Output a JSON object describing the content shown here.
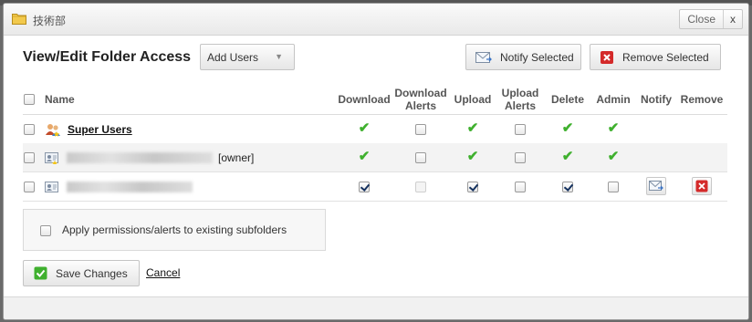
{
  "window": {
    "title": "技術部",
    "close_label": "Close",
    "close_x": "x"
  },
  "heading": "View/Edit Folder Access",
  "toolbar": {
    "add_users_label": "Add Users",
    "notify_selected_label": "Notify Selected",
    "remove_selected_label": "Remove Selected"
  },
  "table": {
    "columns": {
      "name": "Name",
      "download": "Download",
      "download_alerts": "Download Alerts",
      "upload": "Upload",
      "upload_alerts": "Upload Alerts",
      "delete": "Delete",
      "admin": "Admin",
      "notify": "Notify",
      "remove": "Remove"
    },
    "rows": [
      {
        "name": "Super Users",
        "type": "group",
        "download": "granted",
        "download_alerts": "unchecked",
        "upload": "granted",
        "upload_alerts": "unchecked",
        "delete": "granted",
        "admin": "granted"
      },
      {
        "name_suffix": "[owner]",
        "type": "user",
        "download": "granted",
        "download_alerts": "unchecked",
        "upload": "granted",
        "upload_alerts": "unchecked",
        "delete": "granted",
        "admin": "granted"
      },
      {
        "type": "user",
        "download": "checked",
        "download_alerts": "disabled",
        "upload": "checked",
        "upload_alerts": "unchecked",
        "delete": "checked",
        "admin": "unchecked",
        "notify_icon": "envelope-icon",
        "remove_icon": "red-x-icon"
      }
    ]
  },
  "subfolders_label": "Apply permissions/alerts to existing subfolders",
  "save_label": "Save Changes",
  "cancel_label": "Cancel",
  "colors": {
    "check_green": "#3fb02e",
    "remove_red": "#d42a2a",
    "checkbox_checked": "#14315f"
  }
}
